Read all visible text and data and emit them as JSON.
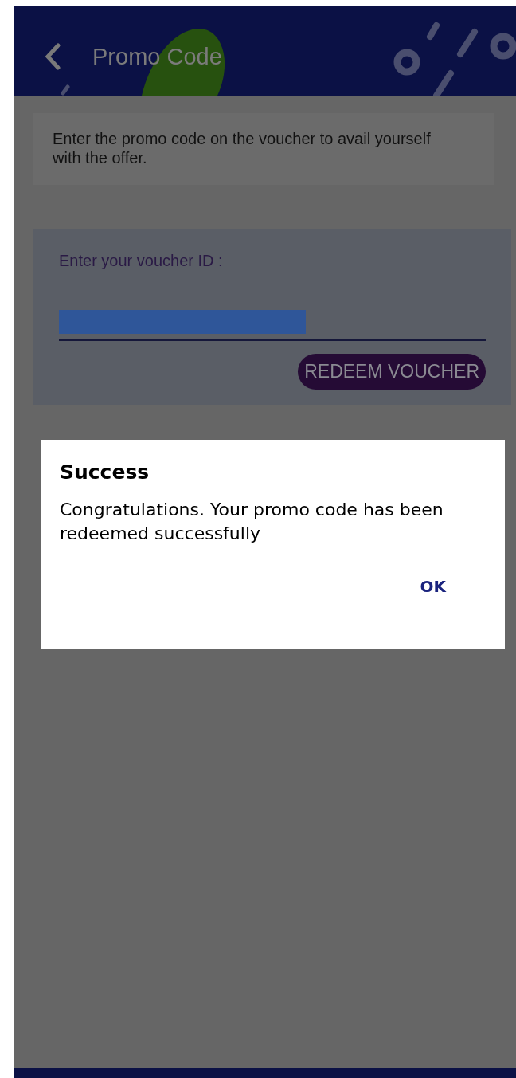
{
  "header": {
    "title": "Promo Code"
  },
  "intro": {
    "text": "Enter the promo code on the voucher to avail yourself with the offer."
  },
  "voucher_form": {
    "label": "Enter your voucher ID :",
    "value_redacted": true,
    "button": "REDEEM VOUCHER"
  },
  "dialog": {
    "title": "Success",
    "message": "Congratulations. Your promo code has been redeemed successfully",
    "button": "OK"
  }
}
